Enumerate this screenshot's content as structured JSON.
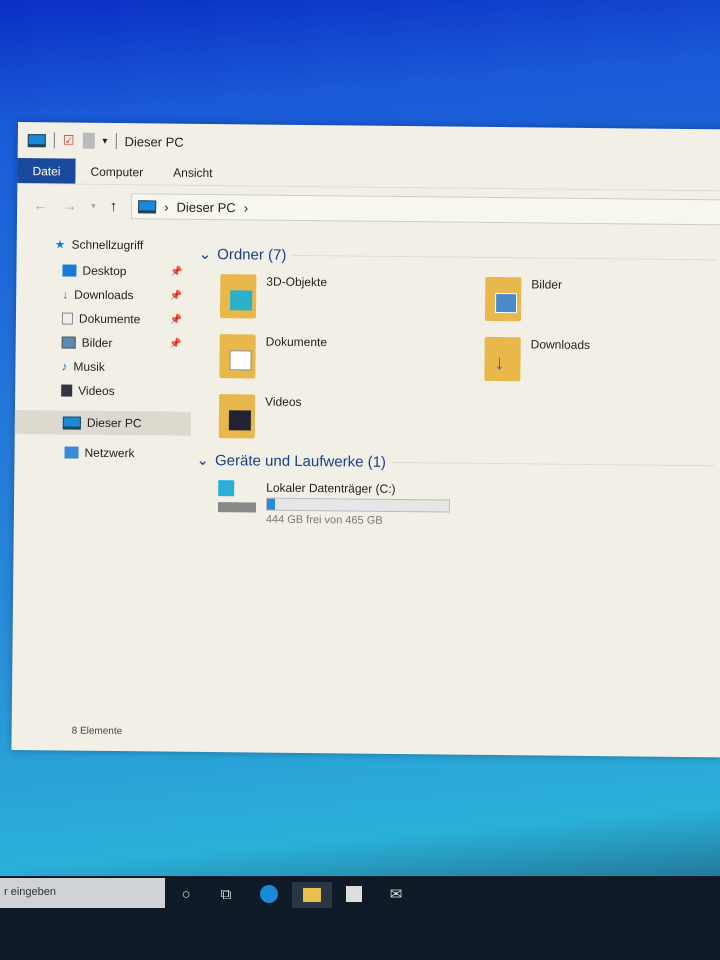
{
  "window": {
    "title": "Dieser PC"
  },
  "ribbon": {
    "tabs": [
      "Datei",
      "Computer",
      "Ansicht"
    ]
  },
  "address": {
    "path": [
      "Dieser PC"
    ]
  },
  "sidebar": {
    "items": [
      {
        "label": "Schnellzugriff",
        "icon": "star-icon"
      },
      {
        "label": "Desktop",
        "icon": "desktop-icon",
        "pinned": true
      },
      {
        "label": "Downloads",
        "icon": "download-icon",
        "pinned": true
      },
      {
        "label": "Dokumente",
        "icon": "document-icon",
        "pinned": true
      },
      {
        "label": "Bilder",
        "icon": "pictures-icon",
        "pinned": true
      },
      {
        "label": "Musik",
        "icon": "music-icon"
      },
      {
        "label": "Videos",
        "icon": "video-icon"
      },
      {
        "label": "Dieser PC",
        "icon": "computer-icon",
        "selected": true
      },
      {
        "label": "Netzwerk",
        "icon": "network-icon"
      }
    ]
  },
  "main": {
    "folders_header": "Ordner (7)",
    "folders": [
      "3D-Objekte",
      "Bilder",
      "Dokumente",
      "Downloads",
      "Videos"
    ],
    "drives_header": "Geräte und Laufwerke (1)",
    "drive": {
      "name": "Lokaler Datenträger (C:)",
      "free_text": "444 GB frei von 465 GB",
      "used_percent": 4.5
    }
  },
  "status": {
    "items": "8 Elemente"
  },
  "taskbar": {
    "search_placeholder": "r eingeben"
  }
}
